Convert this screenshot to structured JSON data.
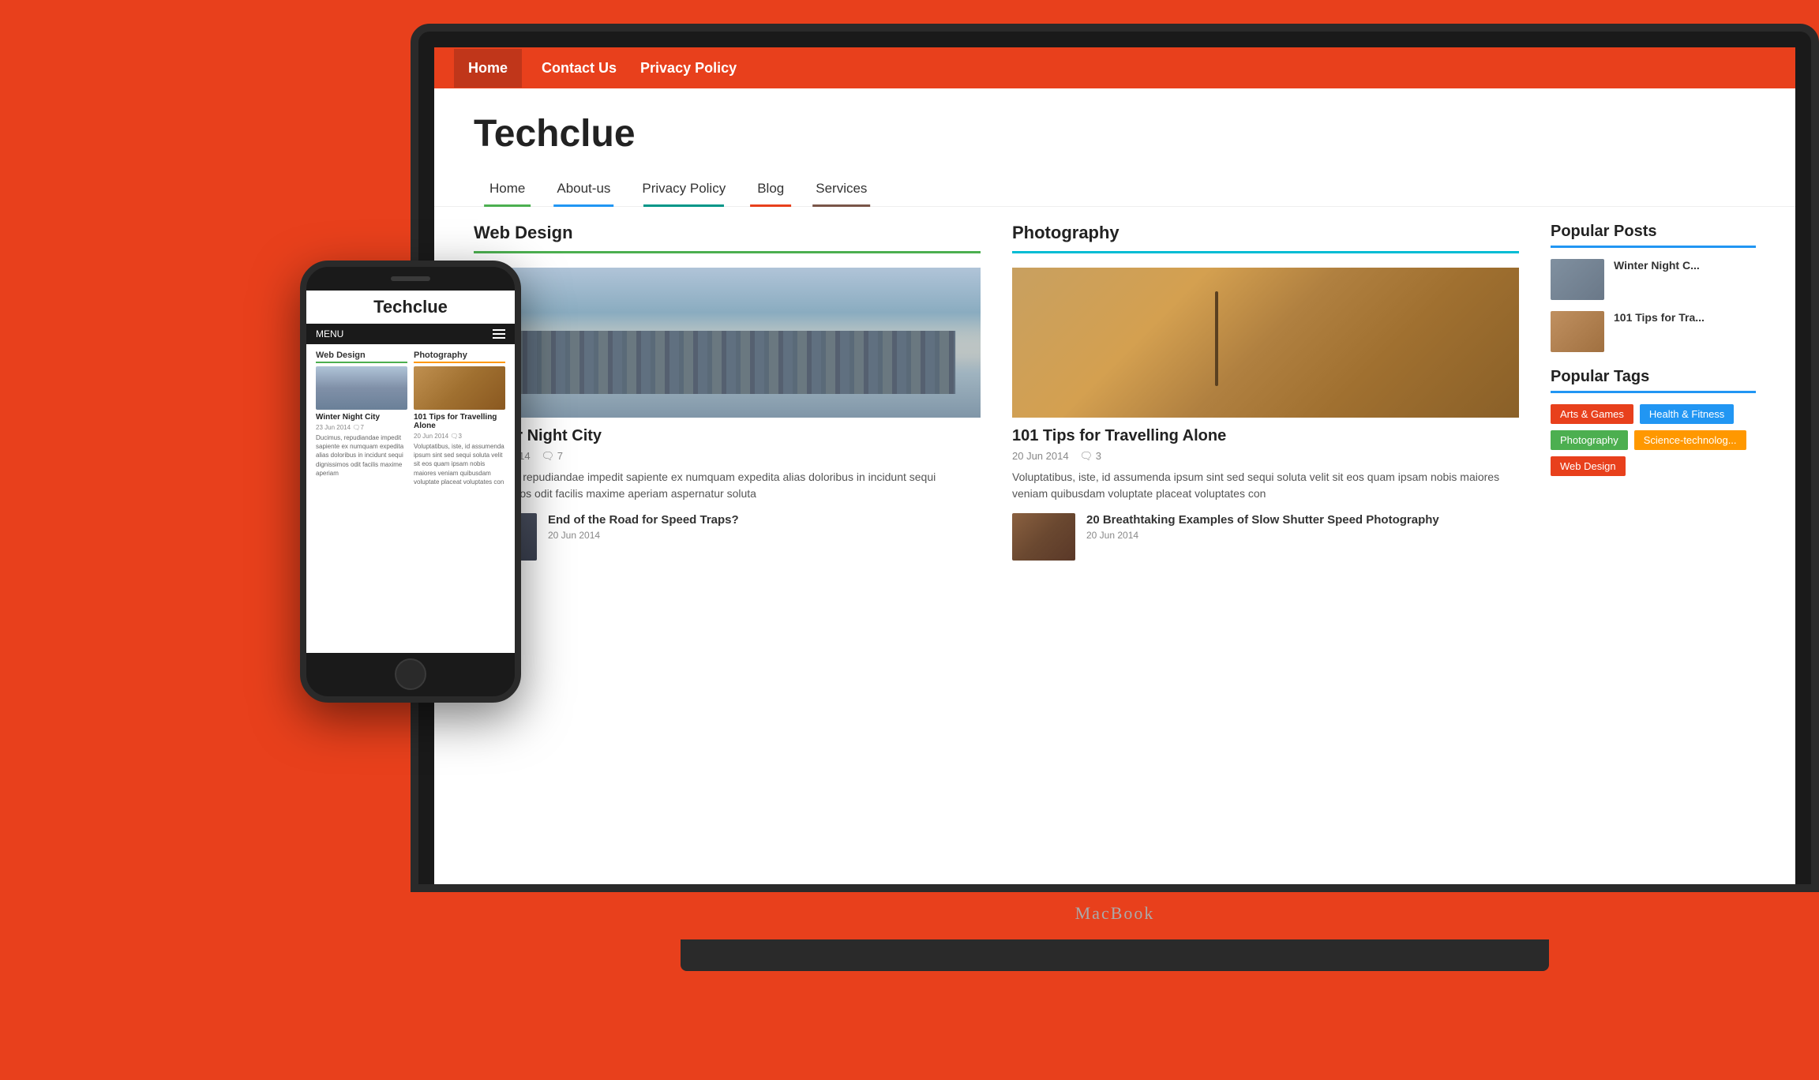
{
  "background": {
    "color": "#e8401c"
  },
  "laptop": {
    "brand": "MacBook"
  },
  "website": {
    "top_nav": {
      "items": [
        {
          "label": "Home",
          "active": true
        },
        {
          "label": "Contact Us"
        },
        {
          "label": "Privacy Policy"
        }
      ]
    },
    "logo": "Techclue",
    "main_nav": {
      "items": [
        {
          "label": "Home",
          "color": "green"
        },
        {
          "label": "About-us",
          "color": "blue"
        },
        {
          "label": "Privacy Policy",
          "color": "teal"
        },
        {
          "label": "Blog",
          "color": "red"
        },
        {
          "label": "Services",
          "color": "brown"
        }
      ]
    },
    "web_design_section": {
      "title": "Web Design",
      "main_article": {
        "title": "Winter Night City",
        "date": "23 Jun 2014",
        "comments": "7",
        "excerpt": "Ducimus, repudiandae impedit sapiente ex numquam expedita alias doloribus in incidunt sequi dignissimos odit facilis maxime aperiam aspernatur soluta"
      },
      "small_articles": [
        {
          "title": "End of the Road for Speed Traps?",
          "date": "20 Jun 2014"
        }
      ]
    },
    "photography_section": {
      "title": "Photography",
      "main_article": {
        "title": "101 Tips for Travelling Alone",
        "date": "20 Jun 2014",
        "comments": "3",
        "excerpt": "Voluptatibus, iste, id assumenda ipsum sint sed sequi soluta velit sit eos quam ipsam nobis maiores veniam quibusdam voluptate placeat voluptates con"
      },
      "small_articles": [
        {
          "title": "20 Breathtaking Examples of Slow Shutter Speed Photography",
          "date": "20 Jun 2014"
        }
      ]
    },
    "sidebar": {
      "popular_posts": {
        "title": "Popular Posts",
        "items": [
          {
            "title": "Winter Night C..."
          },
          {
            "title": "101 Tips for Tra..."
          }
        ]
      },
      "popular_tags": {
        "title": "Popular Tags",
        "items": [
          {
            "label": "Arts & Games",
            "color": "tag-red"
          },
          {
            "label": "Health & Fitness",
            "color": "tag-blue"
          },
          {
            "label": "Photography",
            "color": "tag-green"
          },
          {
            "label": "Science-technolog...",
            "color": "tag-orange"
          },
          {
            "label": "Web Design",
            "color": "tag-red"
          }
        ]
      }
    }
  },
  "phone": {
    "title": "Techclue",
    "menu_label": "MENU",
    "sections": [
      {
        "title": "Web Design",
        "color": "green",
        "article": {
          "title": "Winter Night City",
          "date": "23 Jun 2014",
          "comments": "7",
          "text": "Ducimus, repudiandae impedit sapiente ex numquam expedita alias doloribus in incidunt sequi dignissimos odit facilis maxime aperiam"
        }
      },
      {
        "title": "Photography",
        "color": "orange",
        "article": {
          "title": "101 Tips for Travelling Alone",
          "date": "20 Jun 2014",
          "comments": "3",
          "text": "Voluptatibus, iste, id assumenda ipsum sint sed sequi soluta velit sit eos quam ipsam nobis maiores veniam quibusdam voluptate placeat voluptates con"
        }
      }
    ]
  }
}
